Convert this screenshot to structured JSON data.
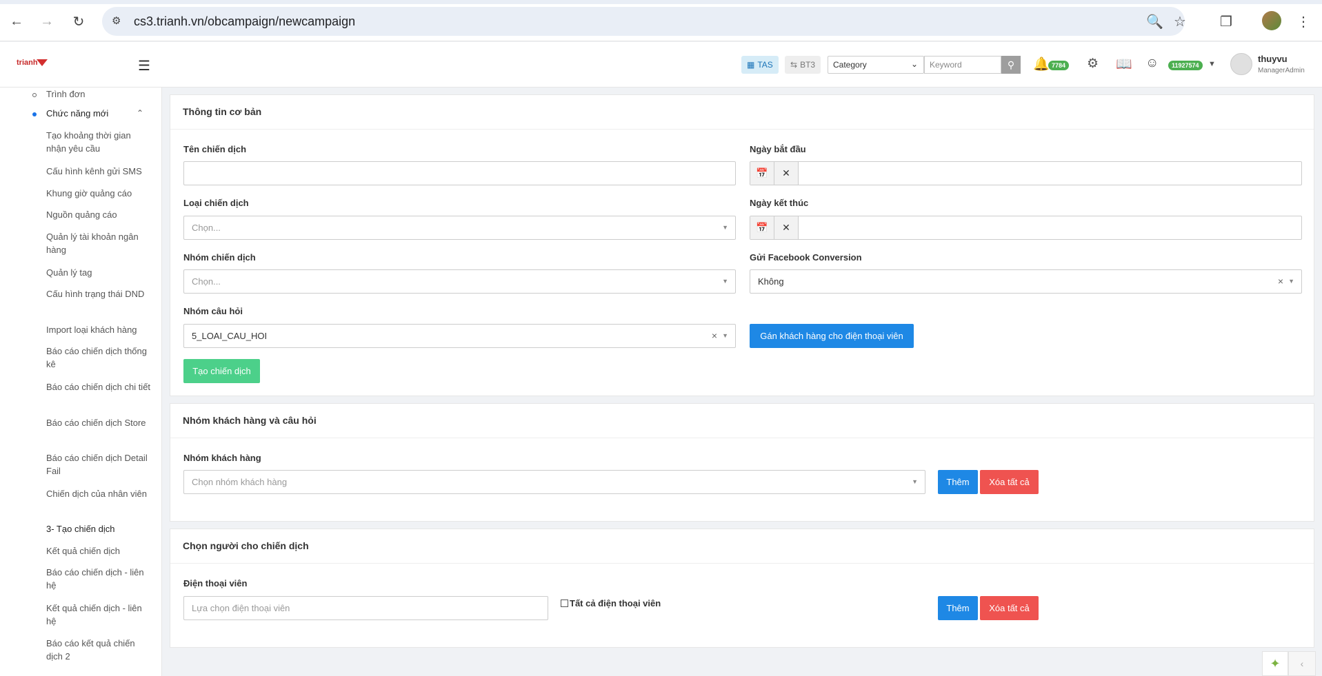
{
  "browser": {
    "url": "cs3.trianh.vn/obcampaign/newcampaign",
    "back_icon": "arrow-left-icon",
    "forward_icon": "arrow-right-icon",
    "reload_icon": "reload-icon"
  },
  "header": {
    "logo_text": "trianh",
    "tas_label": "TAS",
    "bt3_label": "BT3",
    "category_value": "Category",
    "keyword_placeholder": "Keyword",
    "notification_count": "7784",
    "balance": "11927574",
    "user_name": "thuyvu",
    "user_role": "ManagerAdmin"
  },
  "sidebar": {
    "items": [
      {
        "label": "Trình đơn"
      },
      {
        "label": "Chức năng mới"
      },
      {
        "label": "Tạo khoảng thời gian nhận yêu cầu"
      },
      {
        "label": "Cấu hình kênh gửi SMS"
      },
      {
        "label": "Khung giờ quảng cáo"
      },
      {
        "label": "Nguồn quảng cáo"
      },
      {
        "label": "Quản lý tài khoản ngân hàng"
      },
      {
        "label": "Quản lý tag"
      },
      {
        "label": "Cấu hình trạng thái DND"
      },
      {
        "label": "Import loại khách hàng"
      },
      {
        "label": "Báo cáo chiến dịch thống kê"
      },
      {
        "label": "Báo cáo chiến dịch chi tiết"
      },
      {
        "label": "Báo cáo chiến dịch Store"
      },
      {
        "label": "Báo cáo chiến dịch Detail Fail"
      },
      {
        "label": "Chiến dịch của nhân viên"
      },
      {
        "label": "3- Tạo chiến dịch"
      },
      {
        "label": "Kết quả chiến dịch"
      },
      {
        "label": "Báo cáo chiến dịch - liên hệ"
      },
      {
        "label": "Kết quả chiến dịch - liên hệ"
      },
      {
        "label": "Báo cáo kết quả chiến dịch 2"
      }
    ]
  },
  "basic_info": {
    "title": "Thông tin cơ bản",
    "campaign_name_label": "Tên chiến dịch",
    "start_date_label": "Ngày bắt đầu",
    "campaign_type_label": "Loại chiến dịch",
    "campaign_type_placeholder": "Chọn...",
    "end_date_label": "Ngày kết thúc",
    "campaign_group_label": "Nhóm chiến dịch",
    "campaign_group_placeholder": "Chọn...",
    "fb_conversion_label": "Gửi Facebook Conversion",
    "fb_conversion_value": "Không",
    "question_group_label": "Nhóm câu hỏi",
    "question_group_value": "5_LOAI_CAU_HOI",
    "assign_button": "Gán khách hàng cho điện thoại viên",
    "create_button": "Tạo chiến dịch"
  },
  "customer_group": {
    "title": "Nhóm khách hàng và câu hỏi",
    "group_label": "Nhóm khách hàng",
    "group_placeholder": "Chọn nhóm khách hàng",
    "add_button": "Thêm",
    "clear_button": "Xóa tất cả"
  },
  "agents": {
    "title": "Chọn người cho chiến dịch",
    "agent_label": "Điện thoại viên",
    "agent_placeholder": "Lựa chọn điện thoại viên",
    "all_agents_label": "Tất cả điện thoại viên",
    "add_button": "Thêm",
    "clear_button": "Xóa tất cả"
  }
}
